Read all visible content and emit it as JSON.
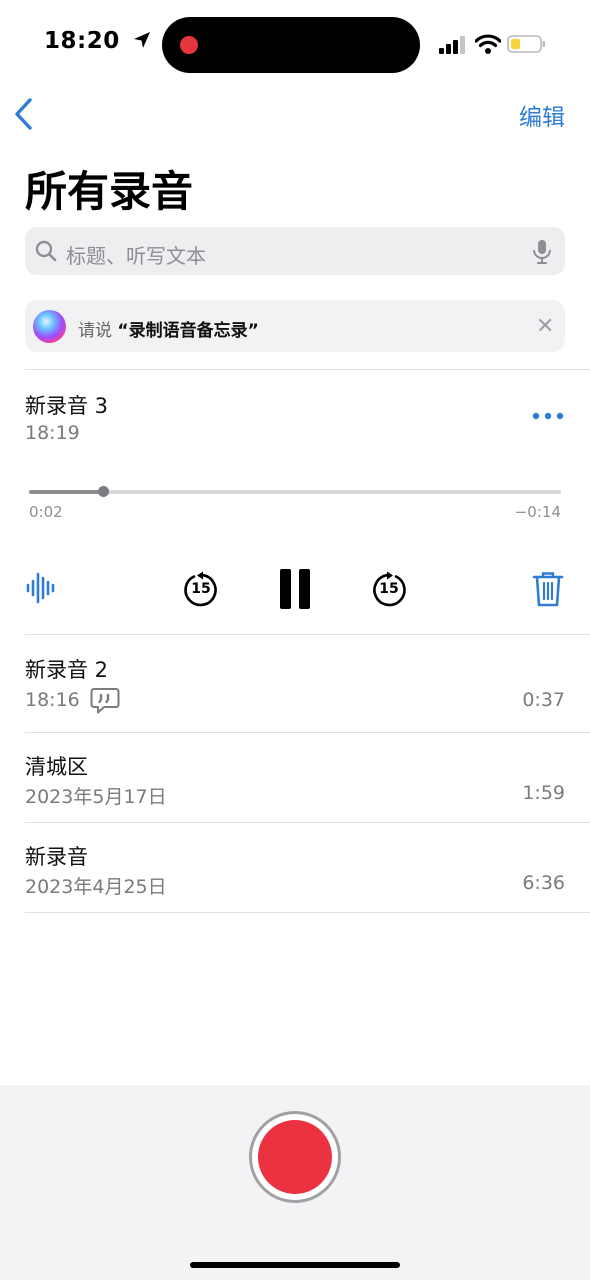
{
  "status_bar": {
    "time": "18:20"
  },
  "nav": {
    "edit_label": "编辑",
    "title": "所有录音"
  },
  "search": {
    "placeholder": "标题、听写文本"
  },
  "siri_suggestion": {
    "prefix": "请说",
    "phrase": "“录制语音备忘录”"
  },
  "active_recording": {
    "title": "新录音 3",
    "time": "18:19",
    "elapsed": "0:02",
    "remaining": "−0:14",
    "progress_fraction": 0.14,
    "skip_back_seconds": "15",
    "skip_forward_seconds": "15"
  },
  "recordings": [
    {
      "title": "新录音 2",
      "date": "18:16",
      "duration": "0:37",
      "has_transcript": true
    },
    {
      "title": "清城区",
      "date": "2023年5月17日",
      "duration": "1:59",
      "has_transcript": false
    },
    {
      "title": "新录音",
      "date": "2023年4月25日",
      "duration": "6:36",
      "has_transcript": false
    }
  ],
  "colors": {
    "accent": "#2f7cd4",
    "record": "#eb3241",
    "secondary_text": "#7a7a7f"
  }
}
